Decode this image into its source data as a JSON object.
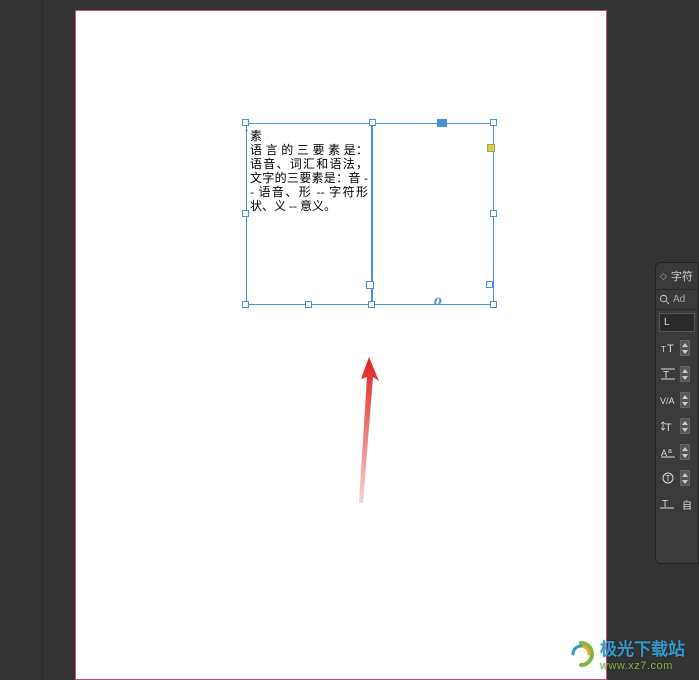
{
  "canvas": {
    "story_char": "素",
    "body_text": "语 言 的 三 要 素 是：语音、词汇和语法，文字的三要素是：音 -- 语音、形 -- 字符形状、义 -- 意义。",
    "italic_o": "o"
  },
  "panel": {
    "title": "字符",
    "search_placeholder": "Ad",
    "style_value": "L",
    "language_label": "自"
  },
  "panel_icons": {
    "row1": "font-size-icon",
    "row2": "leading-icon",
    "row3": "kerning-icon",
    "row4": "vertical-scale-icon",
    "row5": "baseline-shift-icon",
    "row6": "char-rotation-icon",
    "row7": "tracking-icon"
  },
  "watermark": {
    "name": "极光下载站",
    "url": "www.xz7.com"
  },
  "colors": {
    "selection": "#4a90d9",
    "bleed": "#c94c7e",
    "arrow": "#e02020"
  }
}
